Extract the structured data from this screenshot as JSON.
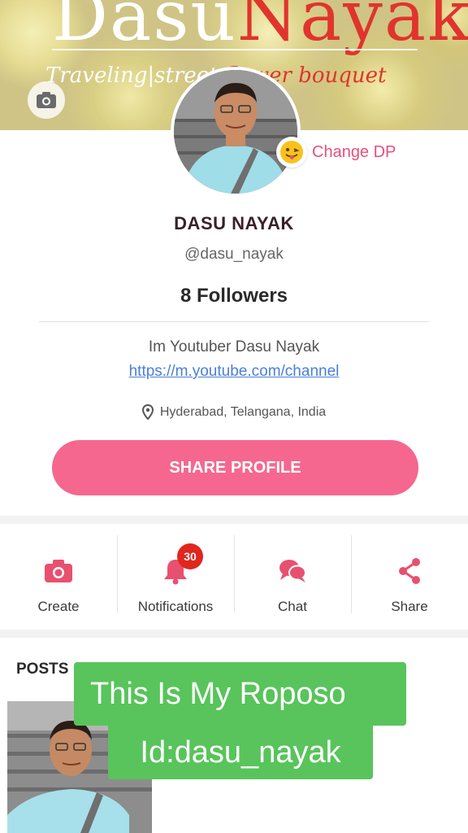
{
  "cover": {
    "title_white": "Dasu",
    "title_red": "Nayak",
    "subtitle_white": "Traveling|street",
    "subtitle_red": "flower bouquet"
  },
  "profile": {
    "change_dp_label": "Change DP",
    "change_dp_icon": "tongue-out-emoji-icon",
    "name": "DASU NAYAK",
    "handle": "@dasu_nayak",
    "followers": "8 Followers",
    "bio": "Im Youtuber Dasu Nayak",
    "link": "https://m.youtube.com/channel",
    "location": "Hyderabad, Telangana, India",
    "share_label": "SHARE PROFILE"
  },
  "actions": [
    {
      "label": "Create",
      "icon": "camera-icon"
    },
    {
      "label": "Notifications",
      "icon": "bell-icon",
      "badge": "30"
    },
    {
      "label": "Chat",
      "icon": "chat-icon"
    },
    {
      "label": "Share",
      "icon": "share-icon"
    }
  ],
  "posts": {
    "title": "POSTS"
  },
  "overlay": {
    "line1": "This Is My Roposo",
    "line2": "Id:dasu_nayak"
  },
  "colors": {
    "accent": "#f5678f",
    "icon_pink": "#e8506f",
    "badge_red": "#e0261d",
    "caption_green": "#58c45b"
  }
}
